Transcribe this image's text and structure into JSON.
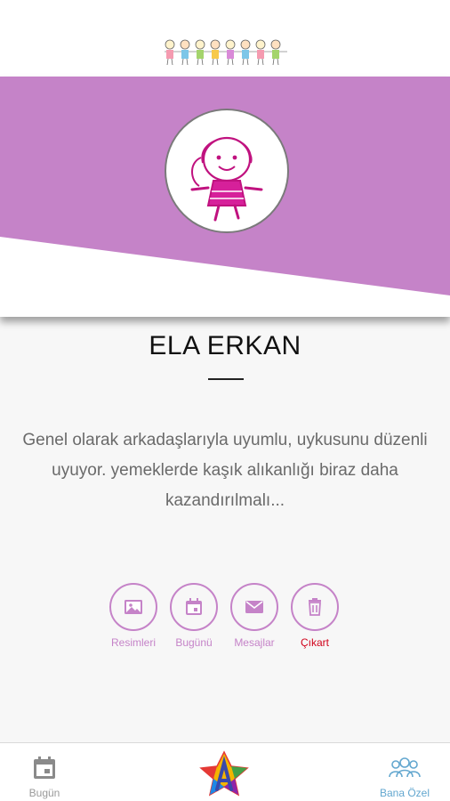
{
  "student": {
    "name": "ELA ERKAN",
    "note": "Genel olarak arkadaşlarıyla uyumlu, uykusunu düzenli uyuyor. yemeklerde kaşık alıkanlığı biraz daha kazandırılmalı..."
  },
  "actions": [
    {
      "label": "Resimleri",
      "icon": "image-icon"
    },
    {
      "label": "Bugünü",
      "icon": "calendar-icon"
    },
    {
      "label": "Mesajlar",
      "icon": "mail-icon"
    },
    {
      "label": "Çıkart",
      "icon": "trash-icon"
    }
  ],
  "tabbar": {
    "today_label": "Bugün",
    "me_label": "Bana Özel"
  },
  "colors": {
    "accent_purple": "#c583c8",
    "danger_red": "#d0021b",
    "tab_active_blue": "#63a7cf"
  }
}
